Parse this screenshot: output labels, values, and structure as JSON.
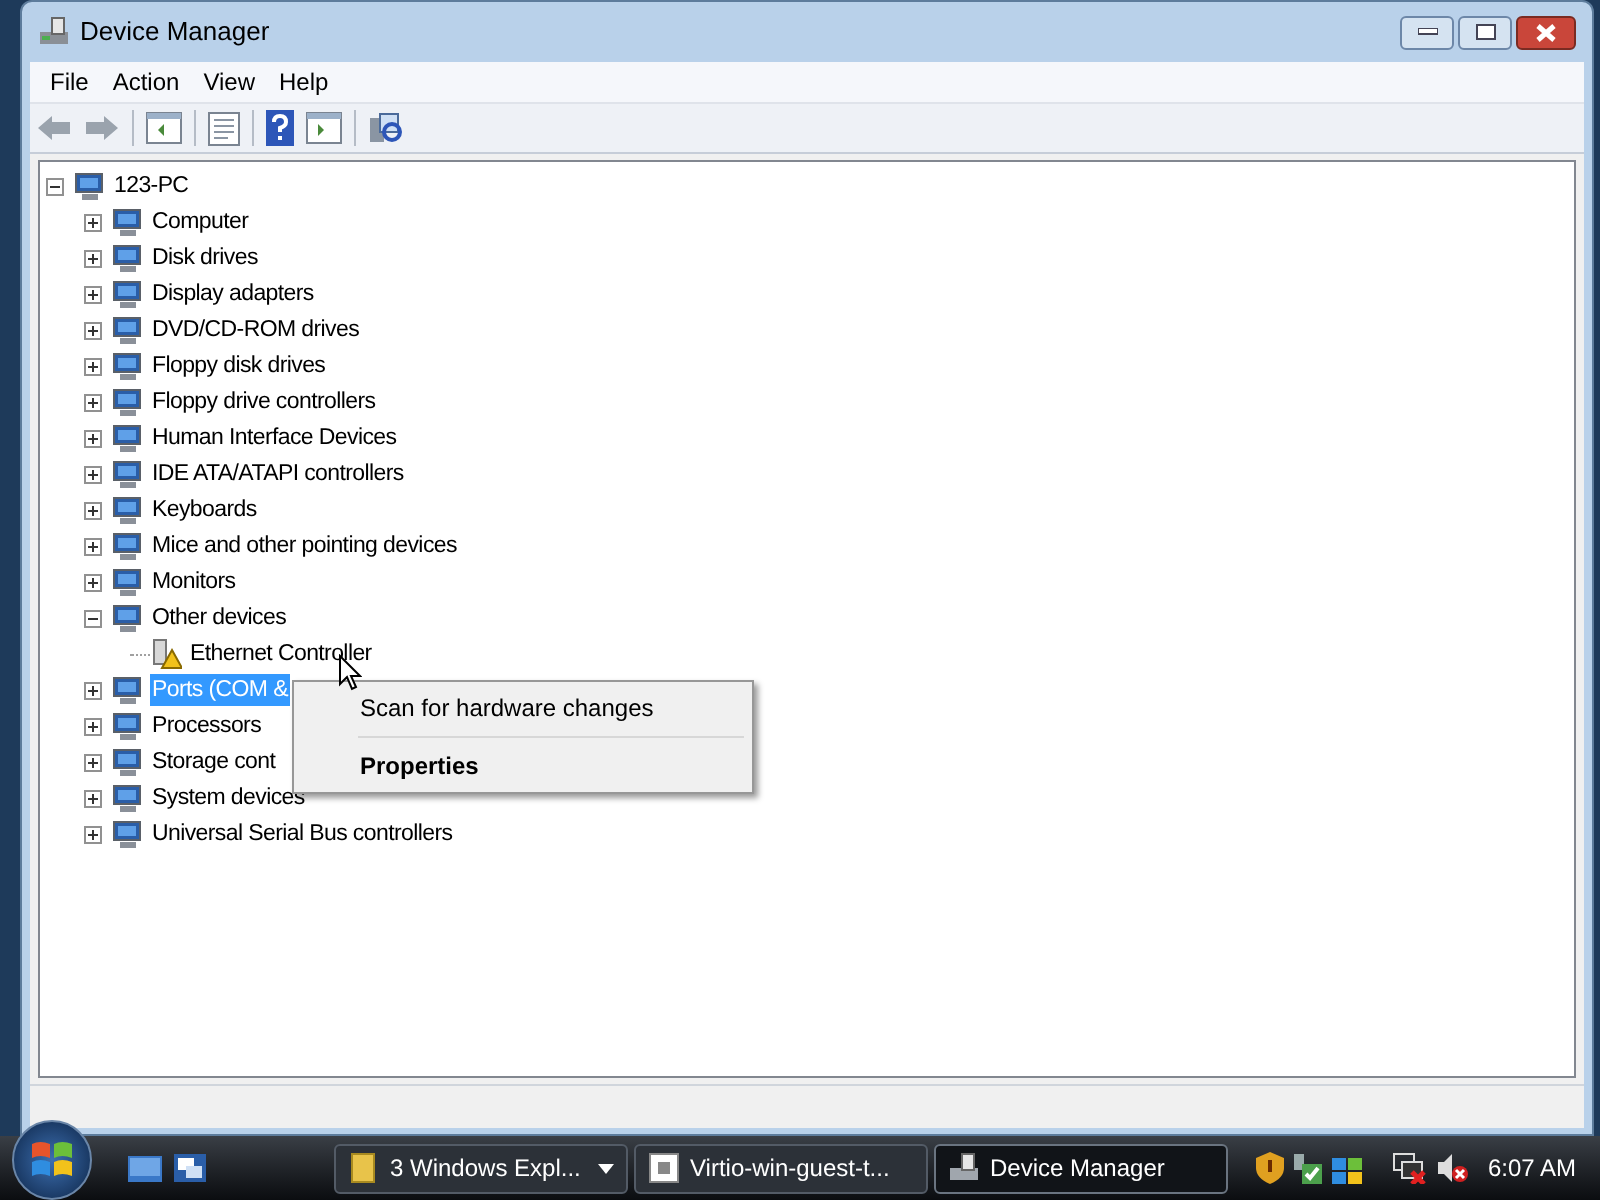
{
  "window": {
    "title": "Device Manager"
  },
  "menu_bar": [
    "File",
    "Action",
    "View",
    "Help"
  ],
  "tree": {
    "label": "123-PC",
    "expanded": true,
    "selected": false,
    "children": [
      {
        "label": "Computer",
        "expanded": false,
        "selected": false
      },
      {
        "label": "Disk drives",
        "expanded": false,
        "selected": false
      },
      {
        "label": "Display adapters",
        "expanded": false,
        "selected": false
      },
      {
        "label": "DVD/CD-ROM drives",
        "expanded": false,
        "selected": false
      },
      {
        "label": "Floppy disk drives",
        "expanded": false,
        "selected": false
      },
      {
        "label": "Floppy drive controllers",
        "expanded": false,
        "selected": false
      },
      {
        "label": "Human Interface Devices",
        "expanded": false,
        "selected": false
      },
      {
        "label": "IDE ATA/ATAPI controllers",
        "expanded": false,
        "selected": false
      },
      {
        "label": "Keyboards",
        "expanded": false,
        "selected": false
      },
      {
        "label": "Mice and other pointing devices",
        "expanded": false,
        "selected": false
      },
      {
        "label": "Monitors",
        "expanded": false,
        "selected": false
      },
      {
        "label": "Other devices",
        "expanded": true,
        "selected": false,
        "children": [
          {
            "label": "Ethernet Controller",
            "warning": true,
            "selected": false
          }
        ]
      },
      {
        "label": "Ports (COM &",
        "expanded": false,
        "selected": true
      },
      {
        "label": "Processors",
        "expanded": false,
        "selected": false
      },
      {
        "label": "Storage cont",
        "expanded": false,
        "selected": false
      },
      {
        "label": "System devices",
        "expanded": false,
        "selected": false
      },
      {
        "label": "Universal Serial Bus controllers",
        "expanded": false,
        "selected": false
      }
    ]
  },
  "context_menu": {
    "items": [
      {
        "label": "Scan for hardware changes",
        "default": false
      },
      {
        "label": "Properties",
        "default": true
      }
    ]
  },
  "taskbar": {
    "buttons": [
      {
        "label": "3 Windows Expl...",
        "kind": "group",
        "selected": false
      },
      {
        "label": "Virtio-win-guest-t...",
        "kind": "window",
        "selected": false
      },
      {
        "label": "Device Manager",
        "kind": "window",
        "selected": true
      }
    ],
    "clock": "6:07 AM"
  }
}
